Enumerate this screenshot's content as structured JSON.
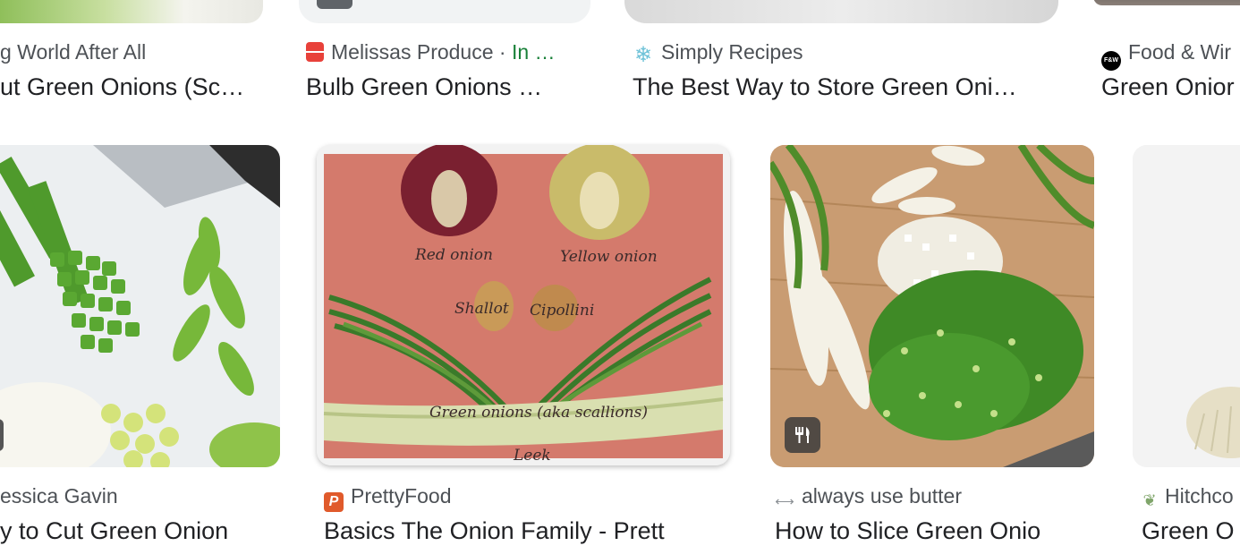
{
  "row1": [
    {
      "source": "g World After All",
      "title": "ut Green Onions (Sc…"
    },
    {
      "source": "Melissas Produce",
      "source_suffix": " · ",
      "source_green": "In …",
      "title": "Bulb Green Onions …"
    },
    {
      "source": "Simply Recipes",
      "title": "The Best Way to Store Green Oni…"
    },
    {
      "source": "Food & Wir",
      "title": "Green Onior"
    }
  ],
  "row2": [
    {
      "source": "essica Gavin",
      "title": "y to Cut Green Onion"
    },
    {
      "source": "PrettyFood",
      "title": "Basics  The Onion Family - Prett",
      "image_labels": {
        "red": "Red onion",
        "yellow": "Yellow onion",
        "shallot": "Shallot",
        "cipollini": "Cipollini",
        "green": "Green onions (aka scallions)",
        "leek": "Leek"
      }
    },
    {
      "source": "always use butter",
      "title": "How to Slice Green Onio"
    },
    {
      "source": "Hitchco",
      "title": "Green O"
    }
  ],
  "favicons": {
    "food_wine": "F&W"
  },
  "colors": {
    "source_text": "#4d5156",
    "title_text": "#202124",
    "in_stock_green": "#188038",
    "prettyfood_favicon": "#e05a2b"
  },
  "icons": {
    "recipe_badge": "fork-knife-icon"
  }
}
